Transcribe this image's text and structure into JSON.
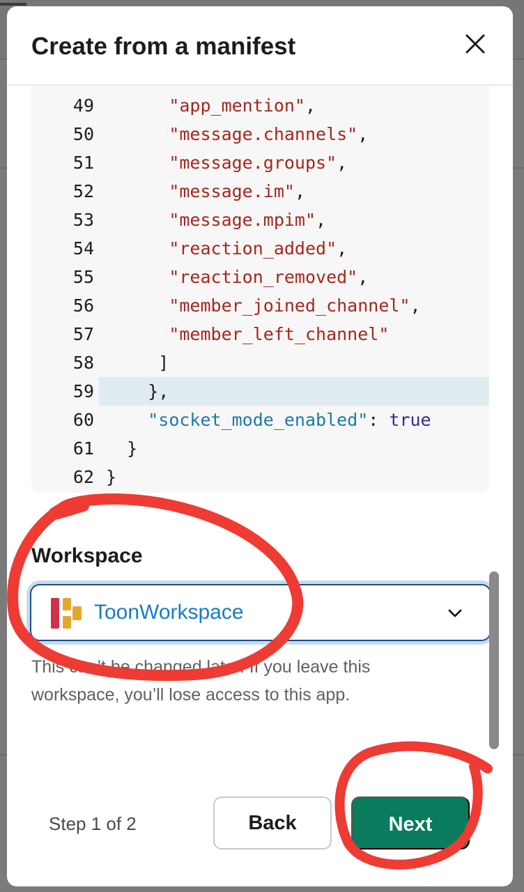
{
  "modal": {
    "title": "Create from a manifest",
    "close_icon": "close-icon"
  },
  "code": {
    "lines": [
      {
        "num": "49",
        "indent": "      ",
        "text": "\"app_mention\"",
        "suffix": ","
      },
      {
        "num": "50",
        "indent": "      ",
        "text": "\"message.channels\"",
        "suffix": ","
      },
      {
        "num": "51",
        "indent": "      ",
        "text": "\"message.groups\"",
        "suffix": ","
      },
      {
        "num": "52",
        "indent": "      ",
        "text": "\"message.im\"",
        "suffix": ","
      },
      {
        "num": "53",
        "indent": "      ",
        "text": "\"message.mpim\"",
        "suffix": ","
      },
      {
        "num": "54",
        "indent": "      ",
        "text": "\"reaction_added\"",
        "suffix": ","
      },
      {
        "num": "55",
        "indent": "      ",
        "text": "\"reaction_removed\"",
        "suffix": ","
      },
      {
        "num": "56",
        "indent": "      ",
        "text": "\"member_joined_channel\"",
        "suffix": ","
      },
      {
        "num": "57",
        "indent": "      ",
        "text": "\"member_left_channel\"",
        "suffix": ""
      },
      {
        "num": "58",
        "indent": "     ",
        "text": "",
        "suffix": "]"
      },
      {
        "num": "59",
        "indent": "    ",
        "text": "",
        "suffix": "},"
      },
      {
        "num": "60",
        "indent": "    ",
        "key": "\"socket_mode_enabled\"",
        "sep": ": ",
        "value": "true"
      },
      {
        "num": "61",
        "indent": "  ",
        "text": "",
        "suffix": "}"
      },
      {
        "num": "62",
        "indent": "",
        "text": "",
        "suffix": "}"
      }
    ],
    "highlight_line": "59"
  },
  "workspace": {
    "label": "Workspace",
    "selected": "ToonWorkspace",
    "help_line1": "This can’t be changed later. If you leave this",
    "help_line2": "workspace, you’ll lose access to this app."
  },
  "footer": {
    "step": "Step 1 of 2",
    "back_label": "Back",
    "next_label": "Next"
  },
  "colors": {
    "accent_green": "#0a7b5c",
    "link_blue": "#1a7bc4",
    "annotation_red": "#ee3b33"
  }
}
